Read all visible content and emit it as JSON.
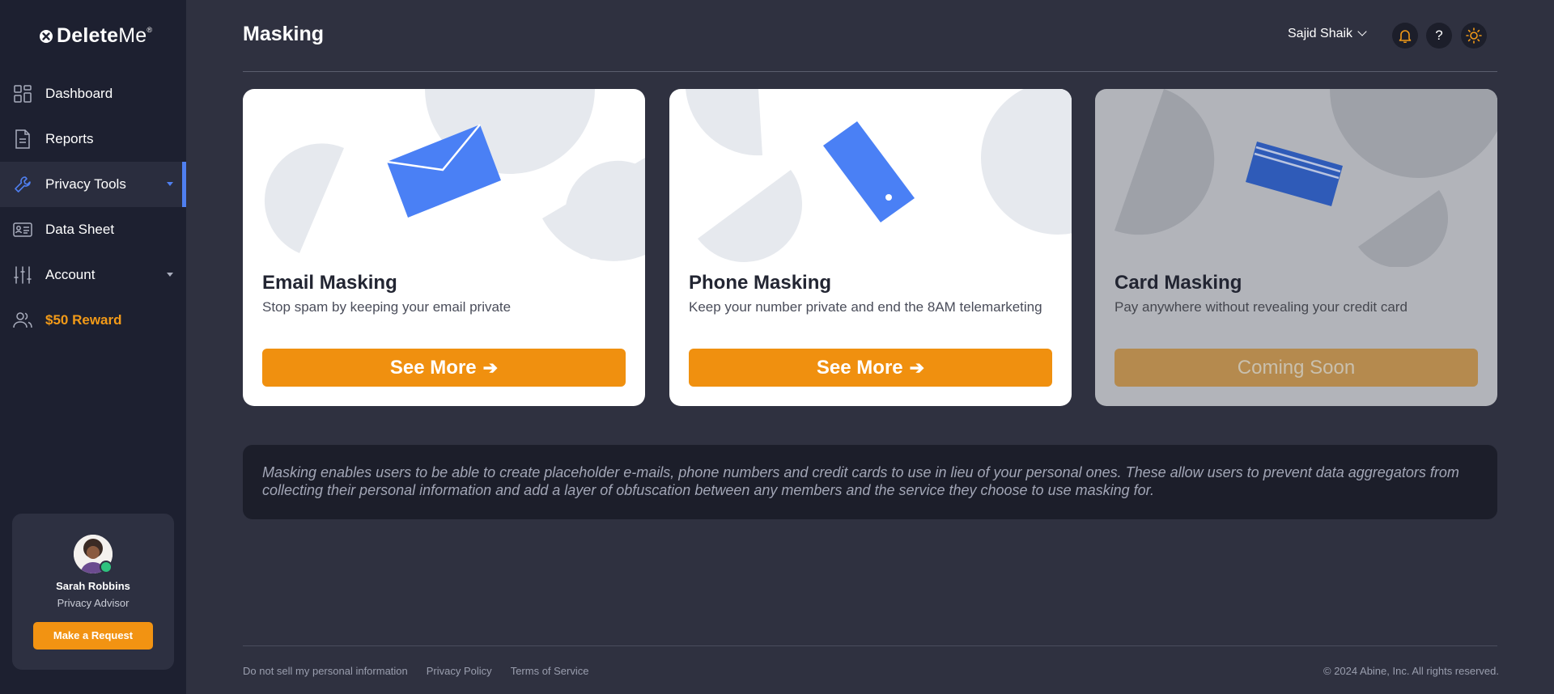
{
  "app": {
    "logo_bold": "Delete",
    "logo_light": "Me",
    "logo_mark": "®"
  },
  "sidebar": {
    "items": [
      {
        "label": "Dashboard",
        "icon": "dashboard-grid-icon"
      },
      {
        "label": "Reports",
        "icon": "document-icon"
      },
      {
        "label": "Privacy Tools",
        "icon": "wrench-icon",
        "active": true
      },
      {
        "label": "Data Sheet",
        "icon": "id-card-icon"
      },
      {
        "label": "Account",
        "icon": "sliders-icon"
      },
      {
        "label": "$50 Reward",
        "icon": "users-icon"
      }
    ],
    "advisor": {
      "name": "Sarah Robbins",
      "role": "Privacy Advisor",
      "button": "Make a Request",
      "status": "online"
    }
  },
  "header": {
    "title": "Masking",
    "user_name": "Sajid Shaik",
    "help_label": "?"
  },
  "cards": [
    {
      "title": "Email Masking",
      "description": "Stop spam by keeping your email private",
      "button": "See More",
      "button_icon": "arrow-right-icon"
    },
    {
      "title": "Phone Masking",
      "description": "Keep your number private and end the 8AM telemarketing",
      "button": "See More",
      "button_icon": "arrow-right-icon"
    },
    {
      "title": "Card Masking",
      "description": "Pay anywhere without revealing your credit card",
      "button": "Coming Soon",
      "disabled": true
    }
  ],
  "info": {
    "text": "Masking enables users to be able to create placeholder e-mails, phone numbers and credit cards to use in lieu of your personal ones. These allow users to prevent data aggregators from collecting their personal information and add a layer of obfuscation between any members and the service they choose to use masking for."
  },
  "footer": {
    "links": [
      "Do not sell my personal information",
      "Privacy Policy",
      "Terms of Service"
    ],
    "copyright": "© 2024 Abine, Inc. All rights reserved."
  },
  "colors": {
    "accent": "#f0900f",
    "active_indicator": "#4f7ff0",
    "sidebar_bg": "#1d2030",
    "page_bg": "#2f3140",
    "illustration_blue": "#4a80f5"
  }
}
